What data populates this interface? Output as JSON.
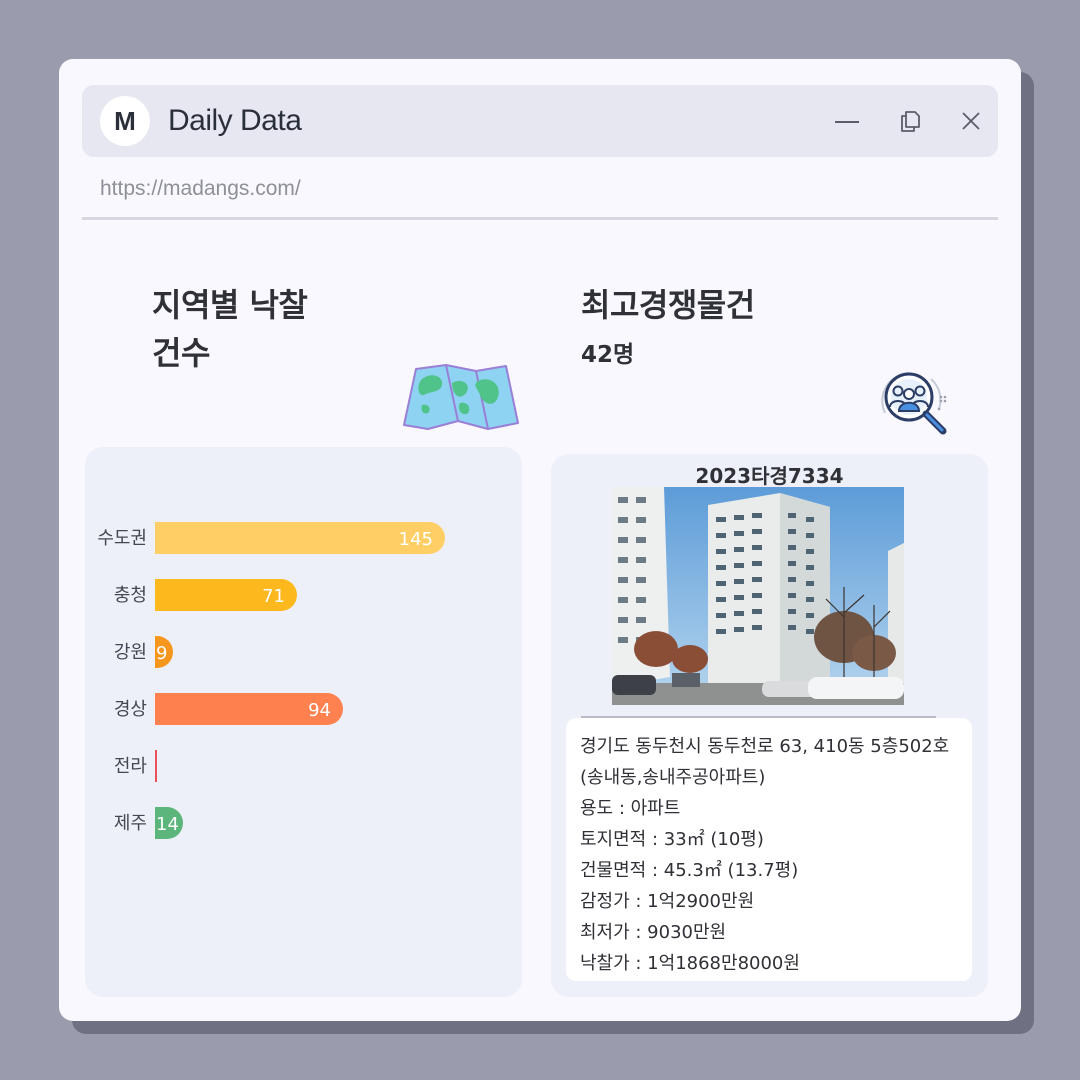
{
  "window": {
    "logo_letter": "M",
    "title": "Daily Data",
    "url": "https://madangs.com/"
  },
  "regional": {
    "title_line1": "지역별 낙찰",
    "title_line2": "건수",
    "chart_data": {
      "type": "bar",
      "orientation": "horizontal",
      "categories": [
        "수도권",
        "충청",
        "강원",
        "경상",
        "전라",
        "제주"
      ],
      "values": [
        145,
        71,
        9,
        94,
        1,
        14
      ],
      "colors": [
        "#ffcf66",
        "#fdb81e",
        "#f7961c",
        "#ff8150",
        "#e8505b",
        "#5cb57a"
      ],
      "value_labels": [
        "145",
        "71",
        "9",
        "94",
        "",
        "14"
      ],
      "xlim": [
        0,
        150
      ]
    }
  },
  "competition": {
    "title": "최고경쟁물건",
    "count": "42명",
    "case_id": "2023타경7334",
    "details": [
      "경기도 동두천시 동두천로 63, 410동 5층502호",
      "(송내동,송내주공아파트)",
      "용도 : 아파트",
      "토지면적 : 33㎡ (10평)",
      "건물면적 : 45.3㎡ (13.7평)",
      "감정가 : 1억2900만원",
      "최저가 :  9030만원",
      "낙찰가 : 1억1868만8000원"
    ]
  },
  "icons": {
    "logo": "logo-icon",
    "minimize": "minimize-icon",
    "restore": "restore-icon",
    "close": "close-icon",
    "map": "map-icon",
    "people_search": "people-search-icon"
  }
}
